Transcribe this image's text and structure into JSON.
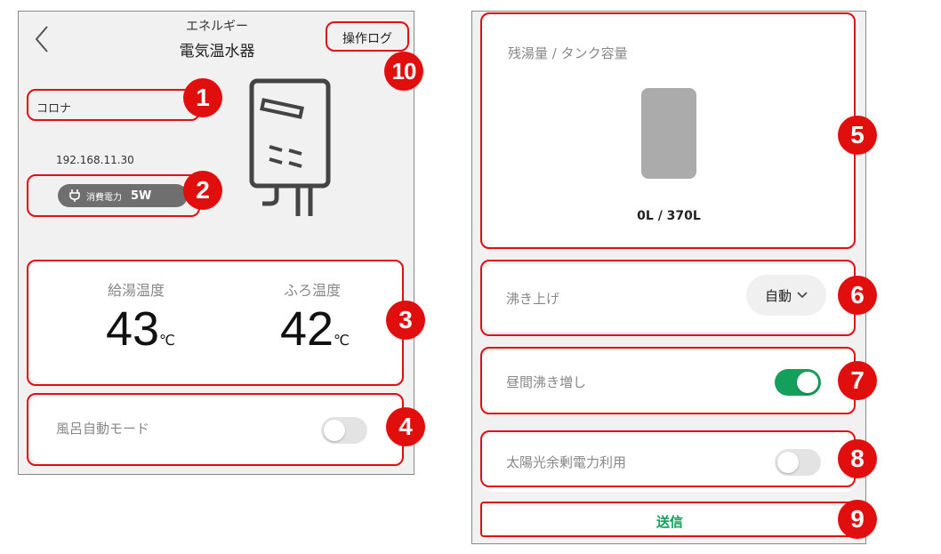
{
  "left": {
    "header": {
      "category": "エネルギー",
      "title": "電気温水器",
      "log_button": "操作ログ"
    },
    "device": {
      "maker": "コロナ",
      "ip": "192.168.11.30",
      "power_label": "消費電力",
      "power_value": "5W"
    },
    "temps": {
      "supply_label": "給湯温度",
      "supply_value": "43",
      "supply_unit": "℃",
      "bath_label": "ふろ温度",
      "bath_value": "42",
      "bath_unit": "℃"
    },
    "bath_auto": {
      "label": "風呂自動モード",
      "on": false
    }
  },
  "right": {
    "tank": {
      "label": "残湯量 / タンク容量",
      "value": "0L / 370L"
    },
    "boil": {
      "label": "沸き上げ",
      "mode": "自動"
    },
    "day_boost": {
      "label": "昼間沸き増し",
      "on": true
    },
    "solar": {
      "label": "太陽光余剰電力利用",
      "on": false
    },
    "send_button": "送信"
  },
  "callouts": [
    "1",
    "2",
    "3",
    "4",
    "5",
    "6",
    "7",
    "8",
    "9",
    "10"
  ],
  "colors": {
    "accent_green": "#14a05a",
    "callout_red": "#e10e0e"
  }
}
